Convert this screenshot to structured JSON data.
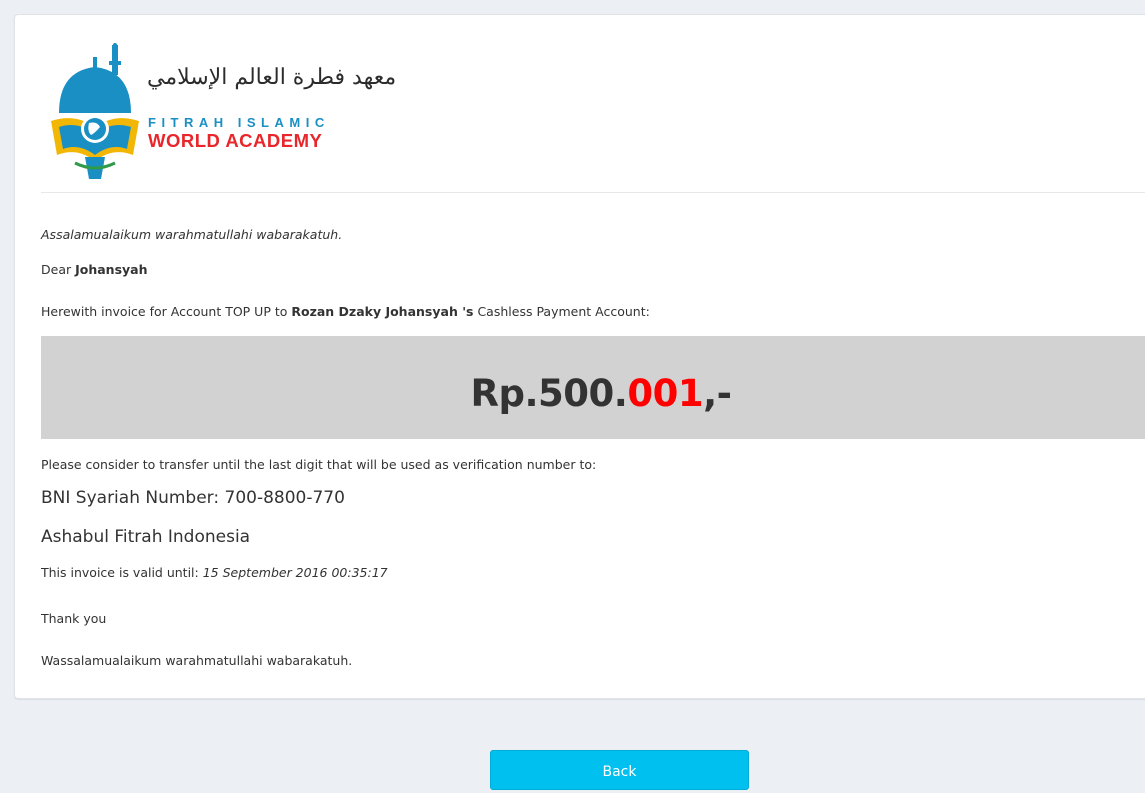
{
  "logo": {
    "arabic": "معهد فطرة العالم الإسلامي",
    "dome_text": "فطرة",
    "line1": "FITRAH ISLAMIC",
    "line2": "WORLD ACADEMY",
    "colors": {
      "blue": "#1a8fc4",
      "red": "#e8262b",
      "gold": "#f2b705",
      "green": "#2e9a4a"
    }
  },
  "invoice": {
    "greeting": "Assalamualaikum warahmatullahi wabarakatuh.",
    "dear_prefix": "Dear",
    "dear_name": "Johansyah",
    "herewith_prefix": "Herewith invoice for Account TOP UP to",
    "student_name": "Rozan Dzaky Johansyah 's",
    "herewith_suffix": "Cashless Payment Account:",
    "amount_prefix": "Rp.500.",
    "amount_digits": "001",
    "amount_suffix": ",-",
    "consider": "Please consider to transfer until the last digit that will be used as verification number to:",
    "bank": "BNI Syariah Number: 700-8800-770",
    "account_owner": "Ashabul Fitrah Indonesia",
    "valid_prefix": "This invoice is valid until:",
    "valid_date": "15 September 2016 00:35:17",
    "thanks": "Thank you",
    "closing": "Wassalamualaikum warahmatullahi wabarakatuh."
  },
  "actions": {
    "back_label": "Back"
  },
  "colors": {
    "amount_box": "#d2d2d2",
    "highlight_digits": "#ff0000",
    "button": "#00c0ef",
    "page_bg": "#ecf0f5"
  }
}
